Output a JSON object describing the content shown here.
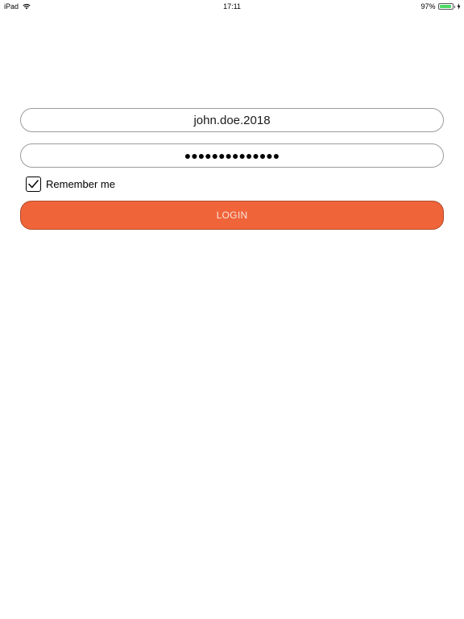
{
  "status_bar": {
    "device": "iPad",
    "time": "17:11",
    "battery_percent": "97%",
    "battery_level": 0.97,
    "battery_color": "#4cd964"
  },
  "login_form": {
    "username_value": "john.doe.2018",
    "password_masked": "●●●●●●●●●●●●●●",
    "remember_label": "Remember me",
    "remember_checked": true,
    "login_label": "LOGIN",
    "accent_color": "#f0643a"
  }
}
